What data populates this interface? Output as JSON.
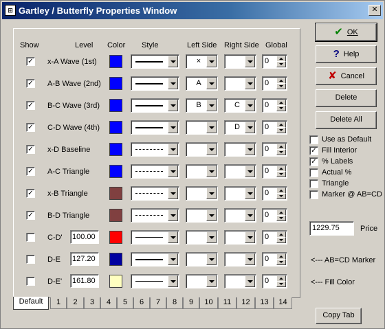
{
  "window": {
    "title": "Gartley / Butterfly Properties Window",
    "close_glyph": "✕",
    "app_icon": "⊞"
  },
  "headers": {
    "show": "Show",
    "level": "Level",
    "color": "Color",
    "style": "Style",
    "left": "Left Side",
    "right": "Right Side",
    "global": "Global"
  },
  "rows": [
    {
      "show": true,
      "label": "x-A Wave (1st)",
      "level": "",
      "color": "#0000ff",
      "style": "solid-thick",
      "left": "×",
      "right": "",
      "global": "0"
    },
    {
      "show": true,
      "label": "A-B Wave (2nd)",
      "level": "",
      "color": "#0000ff",
      "style": "solid-thick",
      "left": "A",
      "right": "",
      "global": "0"
    },
    {
      "show": true,
      "label": "B-C Wave (3rd)",
      "level": "",
      "color": "#0000ff",
      "style": "solid-thick",
      "left": "B",
      "right": "C",
      "global": "0"
    },
    {
      "show": true,
      "label": "C-D Wave (4th)",
      "level": "",
      "color": "#0000ff",
      "style": "solid-thick",
      "left": "",
      "right": "D",
      "global": "0"
    },
    {
      "show": true,
      "label": "x-D Baseline",
      "level": "",
      "color": "#0000ff",
      "style": "dashed",
      "left": "",
      "right": "",
      "global": "0"
    },
    {
      "show": true,
      "label": "A-C Triangle",
      "level": "",
      "color": "#0000ff",
      "style": "dashed",
      "left": "",
      "right": "",
      "global": "0"
    },
    {
      "show": true,
      "label": "x-B Triangle",
      "level": "",
      "color": "#804040",
      "style": "dashed",
      "left": "",
      "right": "",
      "global": "0"
    },
    {
      "show": true,
      "label": "B-D Triangle",
      "level": "",
      "color": "#804040",
      "style": "dashed",
      "left": "",
      "right": "",
      "global": "0"
    },
    {
      "show": false,
      "label": "C-D'",
      "level": "100.00",
      "color": "#ff0000",
      "style": "solid-thin",
      "left": "",
      "right": "",
      "global": "0"
    },
    {
      "show": false,
      "label": "D-E",
      "level": "127.20",
      "color": "#0000a0",
      "style": "solid-thick",
      "left": "",
      "right": "",
      "global": "0"
    },
    {
      "show": false,
      "label": "D-E'",
      "level": "161.80",
      "color": "#ffffc0",
      "style": "solid-thin",
      "left": "",
      "right": "",
      "global": "0"
    }
  ],
  "tabs": [
    "Default",
    "1",
    "2",
    "3",
    "4",
    "5",
    "6",
    "7",
    "8",
    "9",
    "10",
    "11",
    "12",
    "13",
    "14"
  ],
  "buttons": {
    "ok": "OK",
    "ok_icon": "✔",
    "help": "Help",
    "help_icon": "?",
    "cancel": "Cancel",
    "cancel_icon": "✘",
    "delete": "Delete",
    "delete_all": "Delete All",
    "copy_tab": "Copy Tab"
  },
  "options": [
    {
      "label": "Use as Default",
      "checked": false
    },
    {
      "label": "Fill Interior",
      "checked": true
    },
    {
      "label": "% Labels",
      "checked": true
    },
    {
      "label": "Actual %",
      "checked": false
    },
    {
      "label": "Triangle",
      "checked": false
    },
    {
      "label": "Marker @ AB=CD",
      "checked": false
    }
  ],
  "price": {
    "value": "1229.75",
    "label": "Price"
  },
  "notes": {
    "marker": "<--- AB=CD Marker",
    "fill": "<--- Fill Color"
  },
  "check_glyph": "✓"
}
